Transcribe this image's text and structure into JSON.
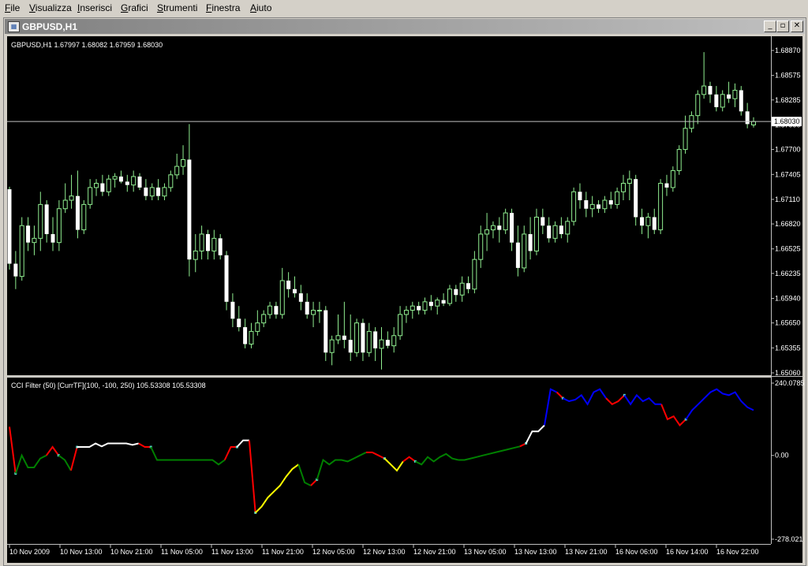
{
  "menu": {
    "items": [
      {
        "name": "file",
        "u": "F",
        "rest": "ile",
        "x": 6
      },
      {
        "name": "visualizza",
        "u": "V",
        "rest": "isualizza",
        "x": 37
      },
      {
        "name": "inserisci",
        "u": "I",
        "rest": "nserisci",
        "x": 98
      },
      {
        "name": "grafici",
        "u": "G",
        "rest": "rafici",
        "x": 153
      },
      {
        "name": "strumenti",
        "u": "S",
        "rest": "trumenti",
        "x": 199
      },
      {
        "name": "finestra",
        "u": "F",
        "rest": "inestra",
        "x": 261
      },
      {
        "name": "aiuto",
        "u": "A",
        "rest": "iuto",
        "x": 317
      }
    ]
  },
  "window": {
    "title": "GBPUSD,H1",
    "minimize": "_",
    "restore": "▫",
    "close": "✕"
  },
  "colors": {
    "background": "#000000",
    "candle_body": "#ffffff",
    "candle_wick": "#90ee90",
    "cci_red": "#ff0000",
    "cci_green": "#008000",
    "cci_white": "#ffffff",
    "cci_yellow": "#ffff00",
    "cci_blue": "#0000ff",
    "marker": "#5ad7c8"
  },
  "main_chart": {
    "header": "GBPUSD,H1  1.67997 1.68082 1.67959 1.68030",
    "current_price": "1.68030",
    "current_price_value": 1.6803,
    "price_labels": [
      "1.68870",
      "1.68575",
      "1.68285",
      "1.67990",
      "1.67700",
      "1.67405",
      "1.67110",
      "1.66820",
      "1.66525",
      "1.66235",
      "1.65940",
      "1.65650",
      "1.65355",
      "1.65060"
    ],
    "ylim": [
      1.6506,
      1.6887
    ]
  },
  "indicator": {
    "header": "CCI Filter (50) [CurrTF](100, -100, 250) 105.53308 105.53308",
    "labels": [
      "240.0785",
      "0.00",
      "-278.021"
    ],
    "ylim": [
      -278.021,
      240.0785
    ]
  },
  "time_axis": {
    "labels": [
      "10 Nov 2009",
      "10 Nov 13:00",
      "10 Nov 21:00",
      "11 Nov 05:00",
      "11 Nov 13:00",
      "11 Nov 21:00",
      "12 Nov 05:00",
      "12 Nov 13:00",
      "12 Nov 21:00",
      "13 Nov 05:00",
      "13 Nov 13:00",
      "13 Nov 21:00",
      "16 Nov 06:00",
      "16 Nov 14:00",
      "16 Nov 22:00"
    ]
  },
  "chart_data": [
    {
      "type": "candlestick",
      "series_label": "GBPUSD,H1",
      "ylim": [
        1.6506,
        1.6887
      ],
      "candles": [
        [
          1.6723,
          1.6726,
          1.6628,
          1.6635
        ],
        [
          1.6635,
          1.665,
          1.6605,
          1.662
        ],
        [
          1.662,
          1.669,
          1.6615,
          1.668
        ],
        [
          1.668,
          1.669,
          1.665,
          1.666
        ],
        [
          1.666,
          1.668,
          1.6645,
          1.6665
        ],
        [
          1.6665,
          1.672,
          1.665,
          1.6705
        ],
        [
          1.6705,
          1.671,
          1.666,
          1.667
        ],
        [
          1.667,
          1.669,
          1.665,
          1.666
        ],
        [
          1.666,
          1.671,
          1.665,
          1.67
        ],
        [
          1.67,
          1.673,
          1.6695,
          1.671
        ],
        [
          1.671,
          1.674,
          1.67,
          1.6715
        ],
        [
          1.6715,
          1.6745,
          1.6665,
          1.6675
        ],
        [
          1.6675,
          1.671,
          1.667,
          1.6705
        ],
        [
          1.6705,
          1.6735,
          1.67,
          1.6725
        ],
        [
          1.6725,
          1.6735,
          1.6715,
          1.673
        ],
        [
          1.673,
          1.674,
          1.6715,
          1.672
        ],
        [
          1.672,
          1.674,
          1.6715,
          1.6735
        ],
        [
          1.6735,
          1.6742,
          1.6725,
          1.6738
        ],
        [
          1.6738,
          1.6745,
          1.673,
          1.6732
        ],
        [
          1.6732,
          1.674,
          1.672,
          1.6728
        ],
        [
          1.6728,
          1.6745,
          1.672,
          1.6738
        ],
        [
          1.6738,
          1.6742,
          1.6722,
          1.6725
        ],
        [
          1.6725,
          1.6735,
          1.671,
          1.6715
        ],
        [
          1.6715,
          1.673,
          1.671,
          1.6725
        ],
        [
          1.6725,
          1.6735,
          1.671,
          1.6715
        ],
        [
          1.6715,
          1.673,
          1.671,
          1.6725
        ],
        [
          1.6725,
          1.6745,
          1.672,
          1.674
        ],
        [
          1.674,
          1.6765,
          1.6735,
          1.675
        ],
        [
          1.675,
          1.6775,
          1.674,
          1.6758
        ],
        [
          1.6758,
          1.68,
          1.662,
          1.664
        ],
        [
          1.664,
          1.667,
          1.6625,
          1.665
        ],
        [
          1.665,
          1.668,
          1.664,
          1.667
        ],
        [
          1.667,
          1.6675,
          1.664,
          1.665
        ],
        [
          1.665,
          1.6675,
          1.664,
          1.6665
        ],
        [
          1.6665,
          1.667,
          1.664,
          1.6645
        ],
        [
          1.6645,
          1.665,
          1.658,
          1.659
        ],
        [
          1.659,
          1.66,
          1.656,
          1.657
        ],
        [
          1.657,
          1.6585,
          1.6555,
          1.656
        ],
        [
          1.656,
          1.657,
          1.6535,
          1.654
        ],
        [
          1.654,
          1.6565,
          1.6535,
          1.6555
        ],
        [
          1.6555,
          1.658,
          1.655,
          1.6565
        ],
        [
          1.6565,
          1.658,
          1.656,
          1.6575
        ],
        [
          1.6575,
          1.659,
          1.657,
          1.6585
        ],
        [
          1.6585,
          1.659,
          1.657,
          1.6575
        ],
        [
          1.6575,
          1.663,
          1.657,
          1.6615
        ],
        [
          1.6615,
          1.6625,
          1.6595,
          1.6605
        ],
        [
          1.6605,
          1.662,
          1.6595,
          1.66
        ],
        [
          1.66,
          1.661,
          1.658,
          1.659
        ],
        [
          1.659,
          1.66,
          1.657,
          1.6575
        ],
        [
          1.6575,
          1.659,
          1.656,
          1.658
        ],
        [
          1.658,
          1.659,
          1.6565,
          1.658
        ],
        [
          1.658,
          1.6585,
          1.652,
          1.653
        ],
        [
          1.653,
          1.655,
          1.6515,
          1.6545
        ],
        [
          1.6545,
          1.6575,
          1.654,
          1.655
        ],
        [
          1.655,
          1.659,
          1.6535,
          1.6545
        ],
        [
          1.6545,
          1.6575,
          1.652,
          1.653
        ],
        [
          1.653,
          1.657,
          1.6525,
          1.6565
        ],
        [
          1.6565,
          1.657,
          1.652,
          1.653
        ],
        [
          1.653,
          1.6565,
          1.6525,
          1.6555
        ],
        [
          1.6555,
          1.656,
          1.652,
          1.6535
        ],
        [
          1.6535,
          1.656,
          1.651,
          1.6545
        ],
        [
          1.6545,
          1.6555,
          1.6535,
          1.6538
        ],
        [
          1.6538,
          1.656,
          1.653,
          1.655
        ],
        [
          1.655,
          1.6585,
          1.6545,
          1.6575
        ],
        [
          1.6575,
          1.6585,
          1.6565,
          1.658
        ],
        [
          1.658,
          1.659,
          1.657,
          1.6585
        ],
        [
          1.6585,
          1.659,
          1.6575,
          1.658
        ],
        [
          1.658,
          1.6595,
          1.6575,
          1.659
        ],
        [
          1.659,
          1.6598,
          1.658,
          1.6585
        ],
        [
          1.6585,
          1.6595,
          1.6575,
          1.6592
        ],
        [
          1.6592,
          1.66,
          1.6585,
          1.6588
        ],
        [
          1.6588,
          1.661,
          1.6585,
          1.6605
        ],
        [
          1.6605,
          1.661,
          1.659,
          1.6598
        ],
        [
          1.6598,
          1.662,
          1.659,
          1.6612
        ],
        [
          1.6612,
          1.662,
          1.66,
          1.6605
        ],
        [
          1.6605,
          1.665,
          1.66,
          1.664
        ],
        [
          1.664,
          1.668,
          1.663,
          1.667
        ],
        [
          1.667,
          1.6695,
          1.665,
          1.6675
        ],
        [
          1.6675,
          1.6685,
          1.6665,
          1.668
        ],
        [
          1.668,
          1.669,
          1.666,
          1.6675
        ],
        [
          1.6675,
          1.67,
          1.667,
          1.6695
        ],
        [
          1.6695,
          1.67,
          1.665,
          1.666
        ],
        [
          1.666,
          1.668,
          1.662,
          1.663
        ],
        [
          1.663,
          1.668,
          1.6625,
          1.667
        ],
        [
          1.667,
          1.669,
          1.664,
          1.665
        ],
        [
          1.665,
          1.67,
          1.6645,
          1.669
        ],
        [
          1.669,
          1.67,
          1.667,
          1.668
        ],
        [
          1.668,
          1.669,
          1.666,
          1.6665
        ],
        [
          1.6665,
          1.6685,
          1.666,
          1.668
        ],
        [
          1.668,
          1.669,
          1.6665,
          1.667
        ],
        [
          1.667,
          1.669,
          1.666,
          1.6685
        ],
        [
          1.6685,
          1.6725,
          1.668,
          1.672
        ],
        [
          1.672,
          1.673,
          1.67,
          1.671
        ],
        [
          1.671,
          1.672,
          1.669,
          1.67
        ],
        [
          1.67,
          1.6715,
          1.669,
          1.6705
        ],
        [
          1.6705,
          1.671,
          1.6695,
          1.67
        ],
        [
          1.67,
          1.6715,
          1.6695,
          1.671
        ],
        [
          1.671,
          1.672,
          1.67,
          1.6705
        ],
        [
          1.6705,
          1.6725,
          1.67,
          1.672
        ],
        [
          1.672,
          1.674,
          1.671,
          1.673
        ],
        [
          1.673,
          1.6745,
          1.671,
          1.6735
        ],
        [
          1.6735,
          1.674,
          1.668,
          1.669
        ],
        [
          1.669,
          1.67,
          1.667,
          1.668
        ],
        [
          1.668,
          1.6695,
          1.6665,
          1.669
        ],
        [
          1.669,
          1.67,
          1.667,
          1.6675
        ],
        [
          1.6675,
          1.6735,
          1.667,
          1.673
        ],
        [
          1.673,
          1.674,
          1.6715,
          1.6725
        ],
        [
          1.6725,
          1.675,
          1.672,
          1.6745
        ],
        [
          1.6745,
          1.6775,
          1.674,
          1.677
        ],
        [
          1.677,
          1.681,
          1.6765,
          1.6795
        ],
        [
          1.6795,
          1.6815,
          1.679,
          1.681
        ],
        [
          1.681,
          1.684,
          1.68,
          1.6835
        ],
        [
          1.6835,
          1.6885,
          1.683,
          1.6845
        ],
        [
          1.6845,
          1.685,
          1.6825,
          1.6835
        ],
        [
          1.6835,
          1.6845,
          1.6815,
          1.682
        ],
        [
          1.682,
          1.684,
          1.6815,
          1.6835
        ],
        [
          1.6835,
          1.685,
          1.6825,
          1.683
        ],
        [
          1.683,
          1.6848,
          1.682,
          1.684
        ],
        [
          1.684,
          1.6845,
          1.681,
          1.6815
        ],
        [
          1.6815,
          1.6825,
          1.6795,
          1.68
        ],
        [
          1.6799,
          1.6808,
          1.6796,
          1.6803
        ]
      ]
    },
    {
      "type": "line",
      "series_label": "CCI Filter (50) [CurrTF](100, -100, 250)",
      "ylim": [
        -278.021,
        240.0785
      ],
      "segments": [
        {
          "color": "red",
          "values": [
            95,
            -60
          ]
        },
        {
          "color": "green",
          "values": [
            -60,
            0,
            -40,
            -40,
            -10,
            0
          ]
        },
        {
          "color": "red",
          "values": [
            0,
            28,
            0
          ]
        },
        {
          "color": "green",
          "values": [
            0,
            -15,
            -50
          ]
        },
        {
          "color": "red",
          "values": [
            -50,
            28
          ]
        },
        {
          "color": "white",
          "values": [
            28,
            28,
            28,
            40,
            30,
            40,
            40,
            40,
            40,
            35,
            40
          ]
        },
        {
          "color": "red",
          "values": [
            40,
            28,
            28
          ]
        },
        {
          "color": "green",
          "values": [
            28,
            -15,
            -15,
            -15,
            -15,
            -15,
            -15,
            -15,
            -15,
            -15,
            -15,
            -30,
            -15
          ]
        },
        {
          "color": "red",
          "values": [
            -15,
            28,
            28
          ]
        },
        {
          "color": "white",
          "values": [
            28,
            50,
            50
          ]
        },
        {
          "color": "red",
          "values": [
            50,
            -190
          ]
        },
        {
          "color": "yellow",
          "values": [
            -190,
            -170,
            -140,
            -120,
            -100,
            -70,
            -45,
            -30
          ]
        },
        {
          "color": "green",
          "values": [
            -30,
            -90,
            -100
          ]
        },
        {
          "color": "red",
          "values": [
            -100,
            -80
          ]
        },
        {
          "color": "green",
          "values": [
            -80,
            -15,
            -30,
            -15,
            -15,
            -20,
            -10,
            0,
            10
          ]
        },
        {
          "color": "red",
          "values": [
            10,
            10,
            0,
            -10
          ]
        },
        {
          "color": "yellow",
          "values": [
            -10,
            -30,
            -50,
            -20
          ]
        },
        {
          "color": "red",
          "values": [
            -20,
            -5,
            -20
          ]
        },
        {
          "color": "green",
          "values": [
            -20,
            -30,
            -5,
            -20,
            -5,
            5,
            -10,
            -15
          ]
        },
        {
          "color": "green",
          "values": [
            -15,
            -15,
            -10,
            -5,
            0,
            5,
            10,
            15,
            20,
            25,
            30
          ]
        },
        {
          "color": "red",
          "values": [
            30,
            40
          ]
        },
        {
          "color": "white",
          "values": [
            40,
            80,
            80,
            100
          ]
        },
        {
          "color": "blue",
          "values": [
            100,
            220,
            210
          ]
        },
        {
          "color": "red",
          "values": [
            210,
            190
          ]
        },
        {
          "color": "blue",
          "values": [
            190,
            180,
            185,
            200,
            170,
            210,
            220,
            190
          ]
        },
        {
          "color": "red",
          "values": [
            190,
            170,
            180,
            200
          ]
        },
        {
          "color": "blue",
          "values": [
            200,
            170,
            200,
            180,
            190,
            170,
            170
          ]
        },
        {
          "color": "red",
          "values": [
            170,
            120,
            130,
            100,
            120
          ]
        },
        {
          "color": "blue",
          "values": [
            120,
            150,
            170,
            190,
            210,
            220,
            205,
            200,
            210,
            180,
            160,
            150
          ]
        }
      ]
    }
  ]
}
